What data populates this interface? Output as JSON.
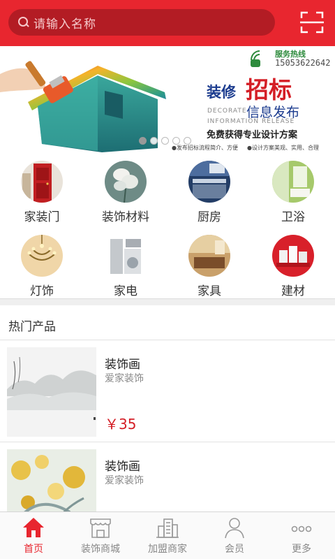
{
  "search": {
    "placeholder": "请输入名称"
  },
  "banner": {
    "hotline_label": "服务热线",
    "hotline_number": "15053622642",
    "title_part1": "装修",
    "title_part2": "招标",
    "decorate_en": "DECORATE",
    "info_cn": "信息发布",
    "info_en": "INFORMATION RELEASE",
    "subtitle": "免费获得专业设计方案",
    "small_note1": "●发布招标流程简介、方便",
    "small_note2": "●设计方案美观、实用、合理",
    "slide_count": 5,
    "active_slide": 1
  },
  "categories": [
    {
      "label": "家装门",
      "icon": "door-photo"
    },
    {
      "label": "装饰材料",
      "icon": "flower-decor-photo"
    },
    {
      "label": "厨房",
      "icon": "kitchen-photo"
    },
    {
      "label": "卫浴",
      "icon": "bathroom-photo"
    },
    {
      "label": "灯饰",
      "icon": "chandelier-photo"
    },
    {
      "label": "家电",
      "icon": "appliances-photo"
    },
    {
      "label": "家具",
      "icon": "furniture-photo"
    },
    {
      "label": "建材",
      "icon": "building-materials-photo"
    }
  ],
  "hot_section": {
    "title": "热门产品"
  },
  "products": [
    {
      "name": "装饰画",
      "shop": "爱家装饰",
      "price": "￥35",
      "image": "ink-landscape-painting"
    },
    {
      "name": "装饰画",
      "shop": "爱家装饰",
      "price": "",
      "image": "flower-painting"
    }
  ],
  "tabbar": [
    {
      "label": "首页",
      "icon": "home-icon",
      "active": true
    },
    {
      "label": "装饰商城",
      "icon": "shop-icon",
      "active": false
    },
    {
      "label": "加盟商家",
      "icon": "buildings-icon",
      "active": false
    },
    {
      "label": "会员",
      "icon": "user-icon",
      "active": false
    },
    {
      "label": "更多",
      "icon": "more-icon",
      "active": false
    }
  ],
  "colors": {
    "brand_red": "#e8262f",
    "price_red": "#d41e26",
    "banner_blue": "#1c3c8f"
  }
}
